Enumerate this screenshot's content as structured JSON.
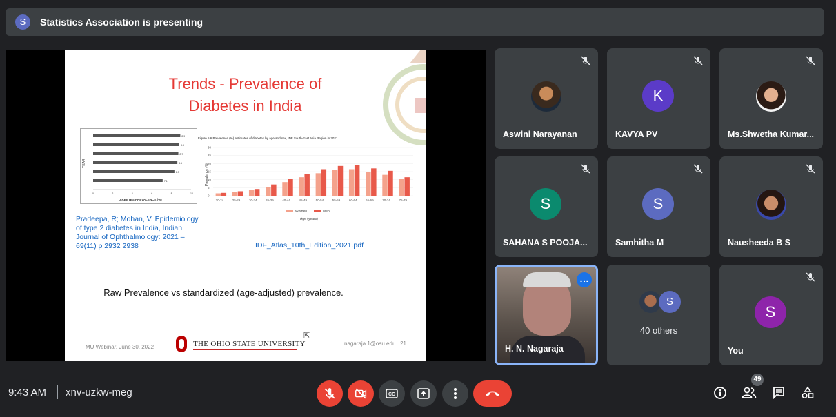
{
  "header": {
    "presenter_initial": "S",
    "presenting_text": "Statistics Association is presenting"
  },
  "slide": {
    "title_line1": "Trends - Prevalence of",
    "title_line2": "Diabetes in India",
    "bar_chart_xlabel": "DIABETES PREVALENCE (%)",
    "bar_chart_ylabel": "YEAR",
    "figure_caption": "Figure 5.6 Prevalence (%) estimates of diabetes by age and sex, IDF South-East Asia Region in 2021",
    "figure_ylabel": "Prevalence (%)",
    "figure_xlabel": "Age (years)",
    "legend_women": "Women",
    "legend_men": "Men",
    "citation": "Pradeepa, R; Mohan, V. Epidemiology of type 2 diabetes in India, Indian Journal of Ophthalmology: 2021 – 69(11) p 2932 2938",
    "atlas_link": "IDF_Atlas_10th_Edition_2021.pdf",
    "raw_vs_std": "Raw Prevalence vs standardized (age-adjusted) prevalence.",
    "footer_left": "MU Webinar, June 30, 2022",
    "university": "THE OHIO STATE UNIVERSITY",
    "footer_right": "nagaraja.1@osu.edu...21"
  },
  "chart_data": [
    {
      "type": "bar",
      "orientation": "horizontal",
      "title": "",
      "xlabel": "DIABETES PREVALENCE (%)",
      "ylabel": "YEAR",
      "categories": [
        "",
        "",
        "",
        "",
        "",
        ""
      ],
      "values": [
        8.9,
        8.8,
        8.7,
        8.6,
        8.3,
        7.1
      ],
      "xlim": [
        0,
        10
      ]
    },
    {
      "type": "bar",
      "title": "Figure 5.6 Prevalence (%) estimates of diabetes by age and sex, IDF South-East Asia Region in 2021",
      "xlabel": "Age (years)",
      "ylabel": "Prevalence (%)",
      "categories": [
        "20-24",
        "25-29",
        "30-34",
        "35-39",
        "40-44",
        "45-49",
        "50-54",
        "55-59",
        "60-64",
        "65-69",
        "70-74",
        "75-79"
      ],
      "series": [
        {
          "name": "Women",
          "values": [
            1.5,
            2.5,
            3.5,
            5.5,
            8.5,
            11.5,
            14,
            16,
            16.5,
            15,
            13,
            10.5
          ]
        },
        {
          "name": "Men",
          "values": [
            1.8,
            2.8,
            4.2,
            7,
            10.5,
            13.5,
            16.5,
            18.5,
            19,
            17,
            15.5,
            11.5
          ]
        }
      ],
      "ylim": [
        0,
        30
      ],
      "legend": "bottom"
    }
  ],
  "participants": [
    {
      "name": "Aswini Narayanan",
      "kind": "photo",
      "muted": true
    },
    {
      "name": "KAVYA PV",
      "kind": "initial",
      "initial": "K",
      "color": "#5b3bc8",
      "muted": true
    },
    {
      "name": "Ms.Shwetha Kumar...",
      "kind": "photo",
      "muted": true
    },
    {
      "name": "SAHANA S POOJA...",
      "kind": "initial",
      "initial": "S",
      "color": "#0b8a6e",
      "muted": true
    },
    {
      "name": "Samhitha M",
      "kind": "initial",
      "initial": "S",
      "color": "#5c6bc0",
      "muted": true
    },
    {
      "name": "Nausheeda B S",
      "kind": "photo",
      "muted": true
    },
    {
      "name": "H. N. Nagaraja",
      "kind": "video",
      "muted": false
    },
    {
      "name": "40 others",
      "kind": "group",
      "initial": "S"
    },
    {
      "name": "You",
      "kind": "initial",
      "initial": "S",
      "color": "#8e24aa",
      "muted": true
    }
  ],
  "footer": {
    "time": "9:43 AM",
    "meeting_code": "xnv-uzkw-meg",
    "participants_badge": "49",
    "cc_label": "CC"
  },
  "icons": {
    "mic_off": "mic-off-icon",
    "cam_off": "camera-off-icon",
    "captions": "captions-icon",
    "present": "present-screen-icon",
    "more": "more-options-icon",
    "hangup": "hang-up-icon",
    "info": "info-icon",
    "people": "people-icon",
    "chat": "chat-icon",
    "activities": "activities-icon"
  }
}
